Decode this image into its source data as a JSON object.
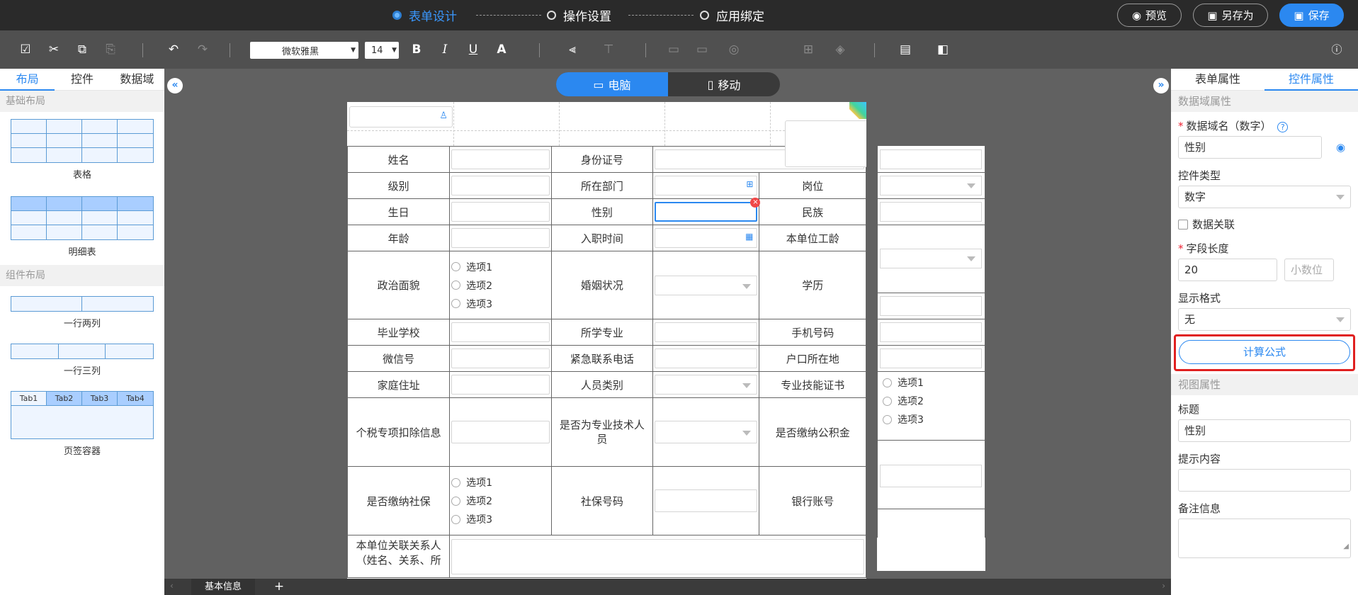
{
  "steps": [
    {
      "label": "表单设计",
      "active": true
    },
    {
      "label": "操作设置",
      "active": false
    },
    {
      "label": "应用绑定",
      "active": false
    }
  ],
  "header_buttons": {
    "preview": "预览",
    "save_as": "另存为",
    "save": "保存"
  },
  "toolbar": {
    "font_family": "微软雅黑",
    "font_size": "14",
    "bold": "B",
    "italic": "I",
    "underline": "U",
    "font_color": "A"
  },
  "left_panel": {
    "tabs": [
      "布局",
      "控件",
      "数据域"
    ],
    "active_tab": "布局",
    "sections": [
      {
        "title": "基础布局",
        "items": [
          "表格",
          "明细表"
        ]
      },
      {
        "title": "组件布局",
        "items": [
          "一行两列",
          "一行三列",
          "页签容器"
        ]
      }
    ],
    "tab_container_labels": [
      "Tab1",
      "Tab2",
      "Tab3",
      "Tab4"
    ]
  },
  "device_toggle": {
    "desktop": "电脑",
    "mobile": "移动",
    "active": "desktop"
  },
  "form": {
    "row1": [
      {
        "l1": "姓名",
        "l2": "身份证号"
      }
    ],
    "labels": {
      "name": "姓名",
      "id_no": "身份证号",
      "level": "级别",
      "dept": "所在部门",
      "position": "岗位",
      "birthday": "生日",
      "gender": "性别",
      "ethnicity": "民族",
      "age": "年龄",
      "entry_date": "入职时间",
      "seniority": "本单位工龄",
      "political": "政治面貌",
      "marital": "婚姻状况",
      "education": "学历",
      "school": "毕业学校",
      "major": "所学专业",
      "phone": "手机号码",
      "wechat": "微信号",
      "emergency": "紧急联系电话",
      "hukou": "户口所在地",
      "address": "家庭住址",
      "staff_type": "人员类别",
      "cert": "专业技能证书",
      "tax": "个税专项扣除信息",
      "is_tech": "是否为专业技术人员",
      "fund": "是否缴纳公积金",
      "social": "是否缴纳社保",
      "social_no": "社保号码",
      "bank": "银行账号",
      "relation": "本单位关联关系人（姓名、关系、所"
    },
    "options": [
      "选项1",
      "选项2",
      "选项3"
    ]
  },
  "bottom_tabs": [
    "基本信息"
  ],
  "bottom_add": "+",
  "right_panel": {
    "tabs": [
      "表单属性",
      "控件属性"
    ],
    "active_tab": "控件属性",
    "data_section": "数据域属性",
    "field_name_label": "数据域名（数字）",
    "field_name_value": "性别",
    "control_type_label": "控件类型",
    "control_type_value": "数字",
    "data_link_label": "数据关联",
    "length_label": "字段长度",
    "length_value": "20",
    "decimal_placeholder": "小数位",
    "format_label": "显示格式",
    "format_value": "无",
    "formula_button": "计算公式",
    "view_section": "视图属性",
    "title_label": "标题",
    "title_value": "性别",
    "hint_label": "提示内容",
    "hint_value": "",
    "remark_label": "备注信息",
    "remark_value": ""
  },
  "colors": {
    "accent": "#2b88f0",
    "highlight_border": "#e02020",
    "topbar": "#2a2a2a",
    "toolbar": "#505050"
  }
}
